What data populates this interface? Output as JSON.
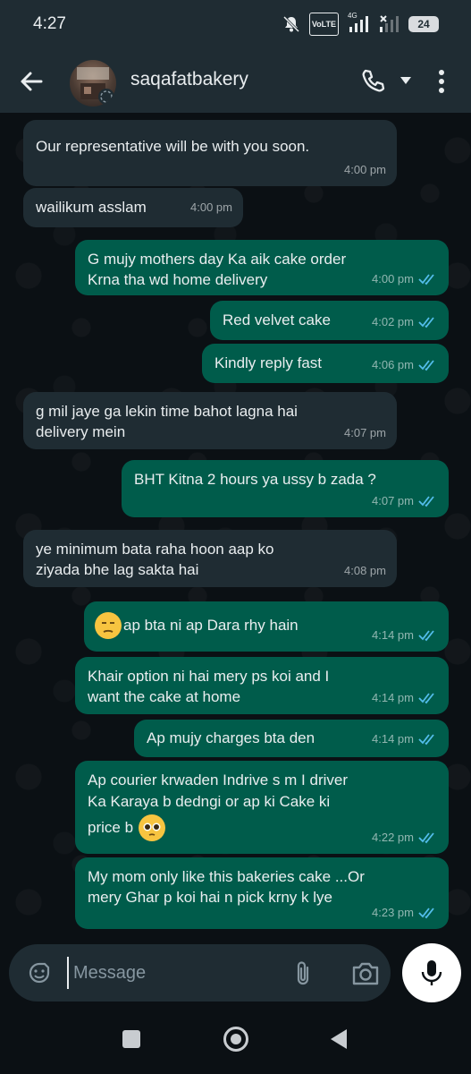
{
  "status_bar": {
    "time": "4:27",
    "network": "4G",
    "volte_line1": "Vo",
    "volte_line2": "LTE",
    "battery": "24",
    "icons": [
      "mute-bell-icon",
      "volte-icon",
      "signal-icon",
      "signal-2-icon",
      "battery-icon"
    ]
  },
  "header": {
    "contact_name": "saqafatbakery",
    "icons": [
      "back-arrow-icon",
      "phone-icon",
      "caret-down-icon",
      "more-vert-icon"
    ]
  },
  "messages": [
    {
      "dir": "in",
      "lines": [
        "Our representative will be with you soon."
      ],
      "time": "4:00 pm"
    },
    {
      "dir": "in",
      "lines": [
        "wailikum asslam"
      ],
      "time": "4:00 pm"
    },
    {
      "dir": "out",
      "lines": [
        "G mujy mothers day Ka aik cake order",
        "Krna tha wd home delivery"
      ],
      "time": "4:00 pm",
      "read": true
    },
    {
      "dir": "out",
      "lines": [
        "Red velvet cake"
      ],
      "time": "4:02 pm",
      "read": true
    },
    {
      "dir": "out",
      "lines": [
        "Kindly reply fast"
      ],
      "time": "4:06 pm",
      "read": true
    },
    {
      "dir": "in",
      "lines": [
        "g mil jaye ga lekin time bahot lagna hai",
        "delivery mein"
      ],
      "time": "4:07 pm"
    },
    {
      "dir": "out",
      "lines": [
        "BHT Kitna 2 hours ya ussy b zada ?"
      ],
      "time": "4:07 pm",
      "read": true
    },
    {
      "dir": "in",
      "lines": [
        "ye minimum bata raha hoon aap ko",
        "ziyada bhe lag sakta hai"
      ],
      "time": "4:08 pm"
    },
    {
      "dir": "out",
      "lines": [
        "ap bta ni ap Dara rhy hain"
      ],
      "time": "4:14 pm",
      "read": true,
      "emoji": "unamused-face"
    },
    {
      "dir": "out",
      "lines": [
        "Khair option ni hai mery ps koi and I",
        "want the cake at home"
      ],
      "time": "4:14 pm",
      "read": true
    },
    {
      "dir": "out",
      "lines": [
        "Ap mujy charges bta den"
      ],
      "time": "4:14 pm",
      "read": true
    },
    {
      "dir": "out",
      "lines": [
        "Ap courier krwaden Indrive s m I driver",
        "Ka Karaya b dedngi or ap ki Cake ki",
        "price b"
      ],
      "time": "4:22 pm",
      "read": true,
      "emoji": "pleading-face"
    },
    {
      "dir": "out",
      "lines": [
        "My mom only like this bakeries cake ...Or",
        "mery Ghar p koi hai n pick krny k lye"
      ],
      "time": "4:23 pm",
      "read": true
    }
  ],
  "input": {
    "placeholder": "Message",
    "icons": [
      "emoji-icon",
      "attach-icon",
      "camera-icon",
      "mic-icon"
    ]
  },
  "nav_bar": {
    "icons": [
      "recents-square-icon",
      "home-circle-icon",
      "back-triangle-icon"
    ]
  },
  "colors": {
    "incoming_bubble": "#1f2c33",
    "outgoing_bubble": "#005c4b",
    "read_ticks": "#53bdeb",
    "background": "#0b1014"
  }
}
